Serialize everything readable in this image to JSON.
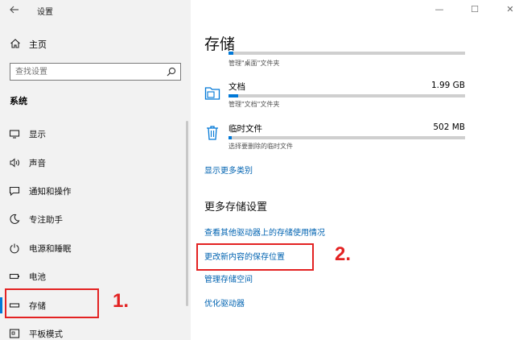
{
  "window": {
    "title": "设置",
    "back_icon": "back-arrow-icon",
    "minimize_glyph": "—",
    "maximize_glyph": "☐",
    "close_glyph": "✕"
  },
  "sidebar": {
    "home_label": "主页",
    "search_placeholder": "查找设置",
    "section_label": "系统",
    "items": [
      {
        "label": "显示",
        "icon": "monitor-icon"
      },
      {
        "label": "声音",
        "icon": "speaker-icon"
      },
      {
        "label": "通知和操作",
        "icon": "notification-icon"
      },
      {
        "label": "专注助手",
        "icon": "moon-icon"
      },
      {
        "label": "电源和睡眠",
        "icon": "power-icon"
      },
      {
        "label": "电池",
        "icon": "battery-icon"
      },
      {
        "label": "存储",
        "icon": "storage-drive-icon",
        "selected": true
      },
      {
        "label": "平板模式",
        "icon": "tablet-icon"
      }
    ]
  },
  "main": {
    "title": "存储",
    "top_caption": "管理\"桌面\"文件夹",
    "entries": [
      {
        "name": "文档",
        "size": "1.99 GB",
        "caption": "管理\"文档\"文件夹",
        "icon": "folder-icon",
        "fill": 0.04
      },
      {
        "name": "临时文件",
        "size": "502 MB",
        "caption": "选择要删除的临时文件",
        "icon": "trash-icon",
        "fill": 0.012
      }
    ],
    "show_more_link": "显示更多类别",
    "more_settings_title": "更多存储设置",
    "links": [
      "查看其他驱动器上的存储使用情况",
      "更改新内容的保存位置",
      "管理存储空间",
      "优化驱动器"
    ]
  },
  "annotations": {
    "step1": "1.",
    "step2": "2.",
    "color": "#e32222"
  },
  "colors": {
    "accent": "#0078d7",
    "link": "#0063b1",
    "sidebar_bg": "#f2f2f2"
  }
}
